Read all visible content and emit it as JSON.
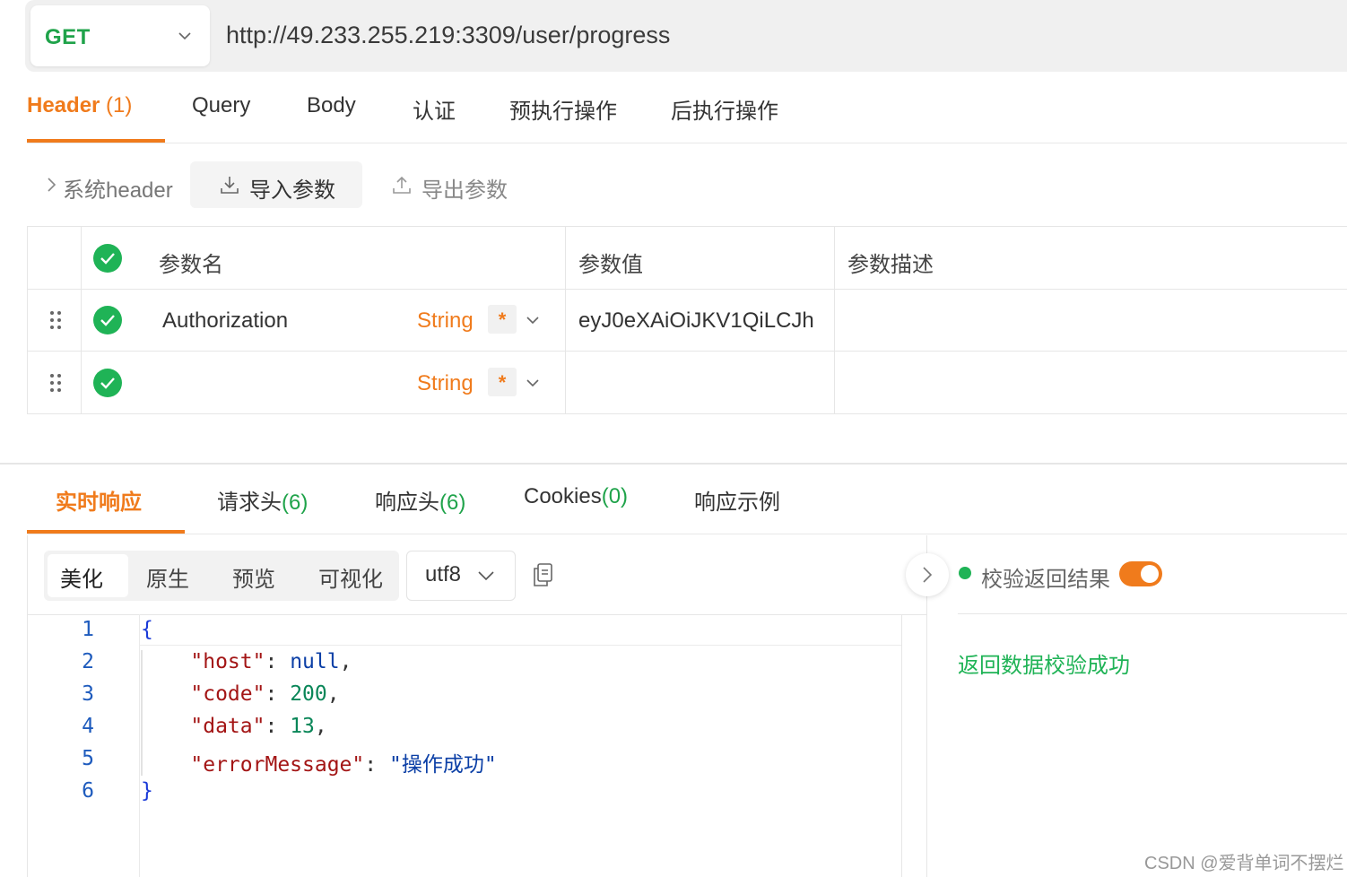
{
  "request": {
    "method": "GET",
    "url": "http://49.233.255.219:3309/user/progress"
  },
  "request_tabs": [
    {
      "label": "Header",
      "count": "(1)"
    },
    {
      "label": "Query"
    },
    {
      "label": "Body"
    },
    {
      "label": "认证"
    },
    {
      "label": "预执行操作"
    },
    {
      "label": "后执行操作"
    }
  ],
  "toolbar": {
    "system_header": "系统header",
    "import_label": "导入参数",
    "export_label": "导出参数"
  },
  "params_table": {
    "headers": [
      "参数名",
      "参数值",
      "参数描述"
    ],
    "rows": [
      {
        "name": "Authorization",
        "type": "String",
        "required": "*",
        "value": "eyJ0eXAiOiJKV1QiLCJh",
        "description": ""
      },
      {
        "name": "",
        "type": "String",
        "required": "*",
        "value": "",
        "description": ""
      }
    ]
  },
  "response_tabs": [
    {
      "label": "实时响应"
    },
    {
      "label": "请求头",
      "count": "(6)"
    },
    {
      "label": "响应头",
      "count": "(6)"
    },
    {
      "label": "Cookies",
      "count": "(0)"
    },
    {
      "label": "响应示例"
    }
  ],
  "view_modes": [
    "美化",
    "原生",
    "预览",
    "可视化"
  ],
  "encoding": "utf8",
  "code": {
    "line_numbers": [
      "1",
      "2",
      "3",
      "4",
      "5",
      "6"
    ],
    "open_brace": "{",
    "close_brace": "}",
    "host_key": "\"host\"",
    "host_value": "null",
    "code_key": "\"code\"",
    "code_value": "200",
    "data_key": "\"data\"",
    "data_value": "13",
    "error_key": "\"errorMessage\"",
    "error_value": "\"操作成功\""
  },
  "verify": {
    "label": "校验返回结果",
    "enabled": true,
    "result": "返回数据校验成功"
  },
  "watermark": "CSDN @爱背单词不摆烂",
  "colors": {
    "accent": "#f07b1c",
    "success": "#1fb356",
    "method_get": "#1fa34a"
  }
}
